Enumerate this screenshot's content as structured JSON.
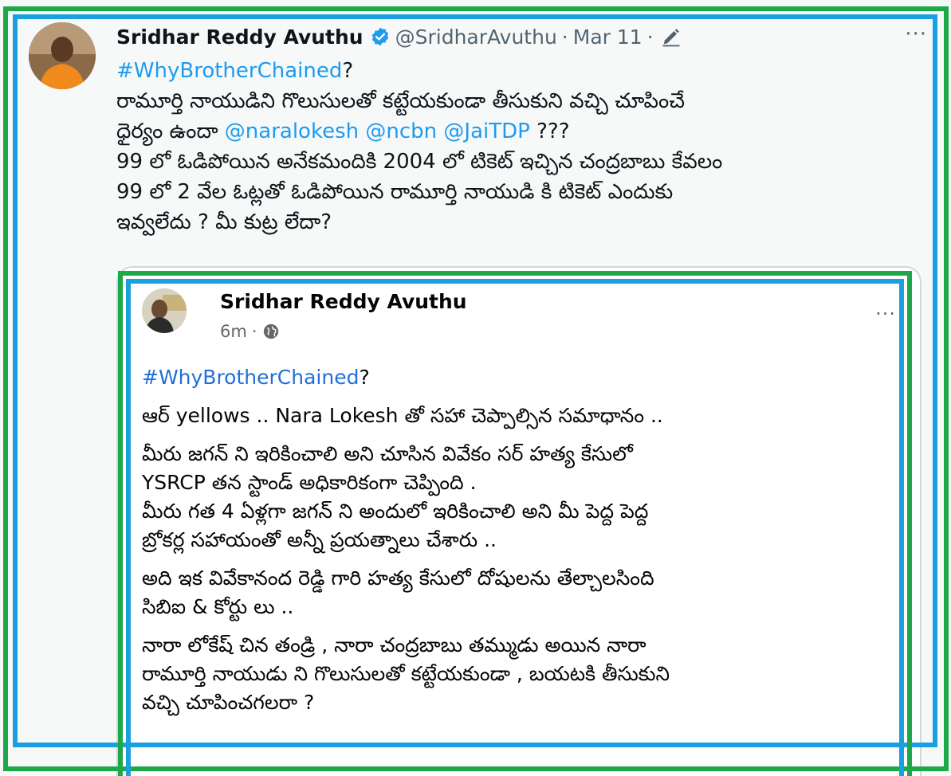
{
  "tweet": {
    "display_name": "Sridhar Reddy Avuthu",
    "handle": "@SridharAvuthu",
    "separator": "·",
    "date": "Mar 11",
    "separator2": "·",
    "more": "···",
    "hashtag": "#WhyBrotherChained",
    "hashtag_suffix": "?",
    "line2": "రామూర్తి నాయుడిని గొలుసులతో కట్టేయకుండా తీసుకుని వచ్చి చూపించే",
    "line3_prefix": "ధైర్యం ఉందా ",
    "mention1": "@naralokesh",
    "mention2": "@ncbn",
    "mention3": "@JaiTDP",
    "line3_suffix": " ???",
    "line4": "99 లో ఓడిపోయిన అనేకమందికి 2004 లో టికెట్ ఇచ్చిన చంద్రబాబు కేవలం",
    "line5": "99 లో 2 వేల ఓట్లతో ఓడిపోయిన రామూర్తి నాయుడి కి టికెట్ ఎందుకు",
    "line6": "ఇవ్వలేదు ?  మీ కుట్ర లేదా?"
  },
  "quote": {
    "name": "Sridhar Reddy Avuthu",
    "time": "6m",
    "dot": "·",
    "more": "···",
    "hashtag": "#WhyBrotherChained",
    "hashtag_suffix": "?",
    "p1": "ఆర్ yellows .. Nara Lokesh తో సహా చెప్పాల్సిన సమాధానం ..",
    "p2_l1": "మీరు జగన్ ని ఇరికించాలి అని చూసిన వివేకం సర్ హత్య కేసులో",
    "p2_l2": "YSRCP  తన స్టాండ్ అధికారికంగా చెప్పింది .",
    "p2_l3": "మీరు గత 4 ఏళ్లగా జగన్ ని అందులో ఇరికించాలి అని మీ పెద్ద పెద్ద",
    "p2_l4": "బ్రోకర్ల సహాయంతో అన్నీ ప్రయత్నాలు చేశారు ..",
    "p3_l1": "అది ఇక వివేకానంద రెడ్డి గారి హత్య కేసులో దోషులను తేల్చాలసింది",
    "p3_l2": "సిబిఐ & కోర్టు లు ..",
    "p4_l1": "నారా లోకేష్ చిన  తండ్రి , నారా చంద్రబాబు తమ్ముడు అయిన నారా",
    "p4_l2": "రామూర్తి నాయుడు ని గొలుసులతో కట్టేయకుండా , బయటకి తీసుకుని",
    "p4_l3": "వచ్చి చూపించగలరా ?"
  },
  "colors": {
    "link": "#1d9bf0",
    "fb_link": "#216fdb",
    "frame_green": "#1fa84a",
    "frame_blue": "#1a9fe0",
    "verified": "#1d9bf0"
  },
  "icons": [
    "verified-badge-icon",
    "edit-pencil-icon",
    "more-horizontal-icon",
    "globe-icon"
  ]
}
